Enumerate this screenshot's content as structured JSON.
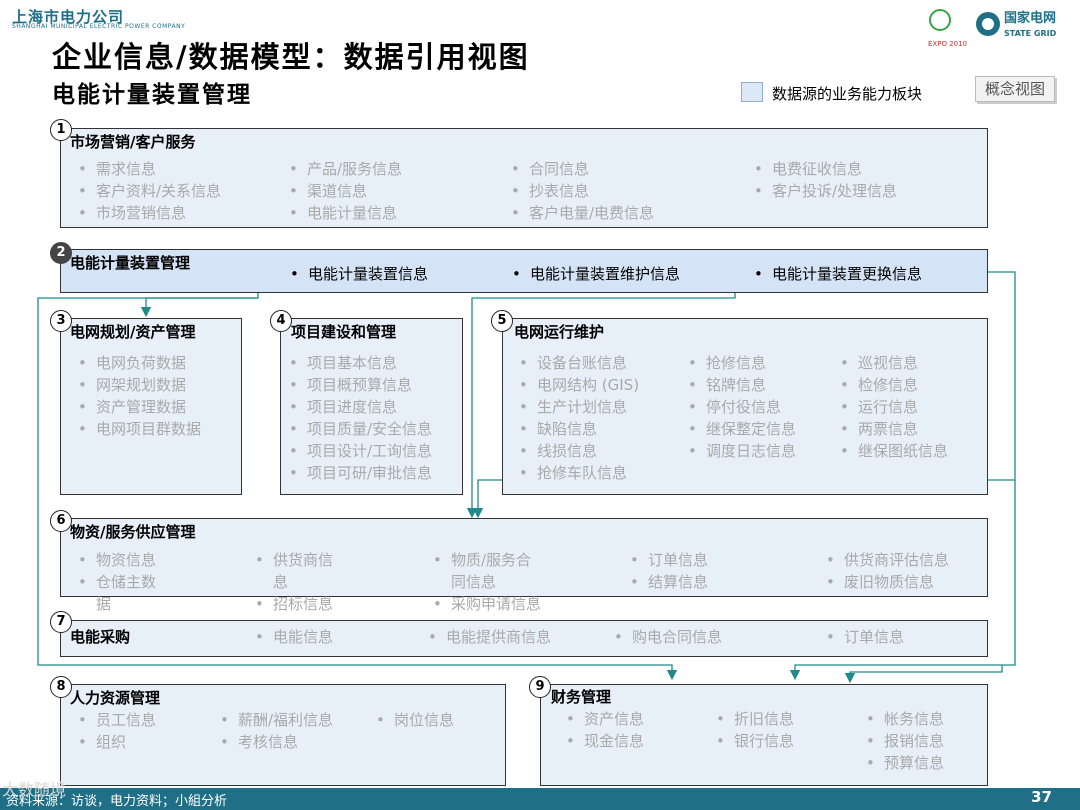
{
  "header": {
    "company": "上海市电力公司",
    "company_en": "SHANGHAI MUNICIPAL ELECTRIC POWER COMPANY",
    "title": "企业信息/数据模型：数据引用视图",
    "subtitle": "电能计量装置管理",
    "legend_label": "数据源的业务能力板块",
    "concept_button": "概念视图",
    "logo_expo": "EXPO 2010",
    "logo_grid_cn": "国家电网",
    "logo_grid_en": "STATE GRID"
  },
  "sections": [
    {
      "num": "1",
      "title": "市场营销/客户服务",
      "items": [
        "需求信息",
        "客户资料/关系信息",
        "市场营销信息",
        "产品/服务信息",
        "渠道信息",
        "电能计量信息",
        "合同信息",
        "抄表信息",
        "客户电量/电费信息",
        "电费征收信息",
        "客户投诉/处理信息"
      ]
    },
    {
      "num": "2",
      "title": "电能计量装置管理",
      "items": [
        "电能计量装置信息",
        "电能计量装置维护信息",
        "电能计量装置更换信息"
      ]
    },
    {
      "num": "3",
      "title": "电网规划/资产管理",
      "items": [
        "电网负荷数据",
        "网架规划数据",
        "资产管理数据",
        "电网项目群数据"
      ]
    },
    {
      "num": "4",
      "title": "项目建设和管理",
      "items": [
        "项目基本信息",
        "项目概预算信息",
        "项目进度信息",
        "项目质量/安全信息",
        "项目设计/工询信息",
        "项目可研/审批信息"
      ]
    },
    {
      "num": "5",
      "title": "电网运行维护",
      "items": [
        "设备台账信息",
        "电网结构 (GIS)",
        "生产计划信息",
        "缺陷信息",
        "线损信息",
        "抢修车队信息",
        "抢修信息",
        "铭牌信息",
        "停付役信息",
        "继保整定信息",
        "调度日志信息",
        "巡视信息",
        "检修信息",
        "运行信息",
        "两票信息",
        "继保图纸信息"
      ]
    },
    {
      "num": "6",
      "title": "物资/服务供应管理",
      "items": [
        "物资信息",
        "仓储主数",
        "据",
        "供货商信",
        "息",
        "招标信息",
        "物质/服务合",
        "同信息",
        "采购申请信息",
        "订单信息",
        "结算信息",
        "供货商评估信息",
        "废旧物质信息"
      ]
    },
    {
      "num": "7",
      "title": "电能采购",
      "items": [
        "电能信息",
        "电能提供商信息",
        "购电合同信息",
        "订单信息"
      ]
    },
    {
      "num": "8",
      "title": "人力资源管理",
      "items": [
        "员工信息",
        "组织",
        "薪酬/福利信息",
        "考核信息",
        "岗位信息"
      ]
    },
    {
      "num": "9",
      "title": "财务管理",
      "items": [
        "资产信息",
        "现金信息",
        "折旧信息",
        "银行信息",
        "帐务信息",
        "报销信息",
        "预算信息"
      ]
    }
  ],
  "footer": {
    "source": "资料来源：访谈，电力资料；小組分析",
    "page": "37",
    "watermark": "大数随境"
  },
  "colors": {
    "section_bg": "#e7f0f9",
    "highlight_bg": "#d4e4f6",
    "teal": "#1f6f86",
    "muted_text": "#a9a9a9"
  }
}
